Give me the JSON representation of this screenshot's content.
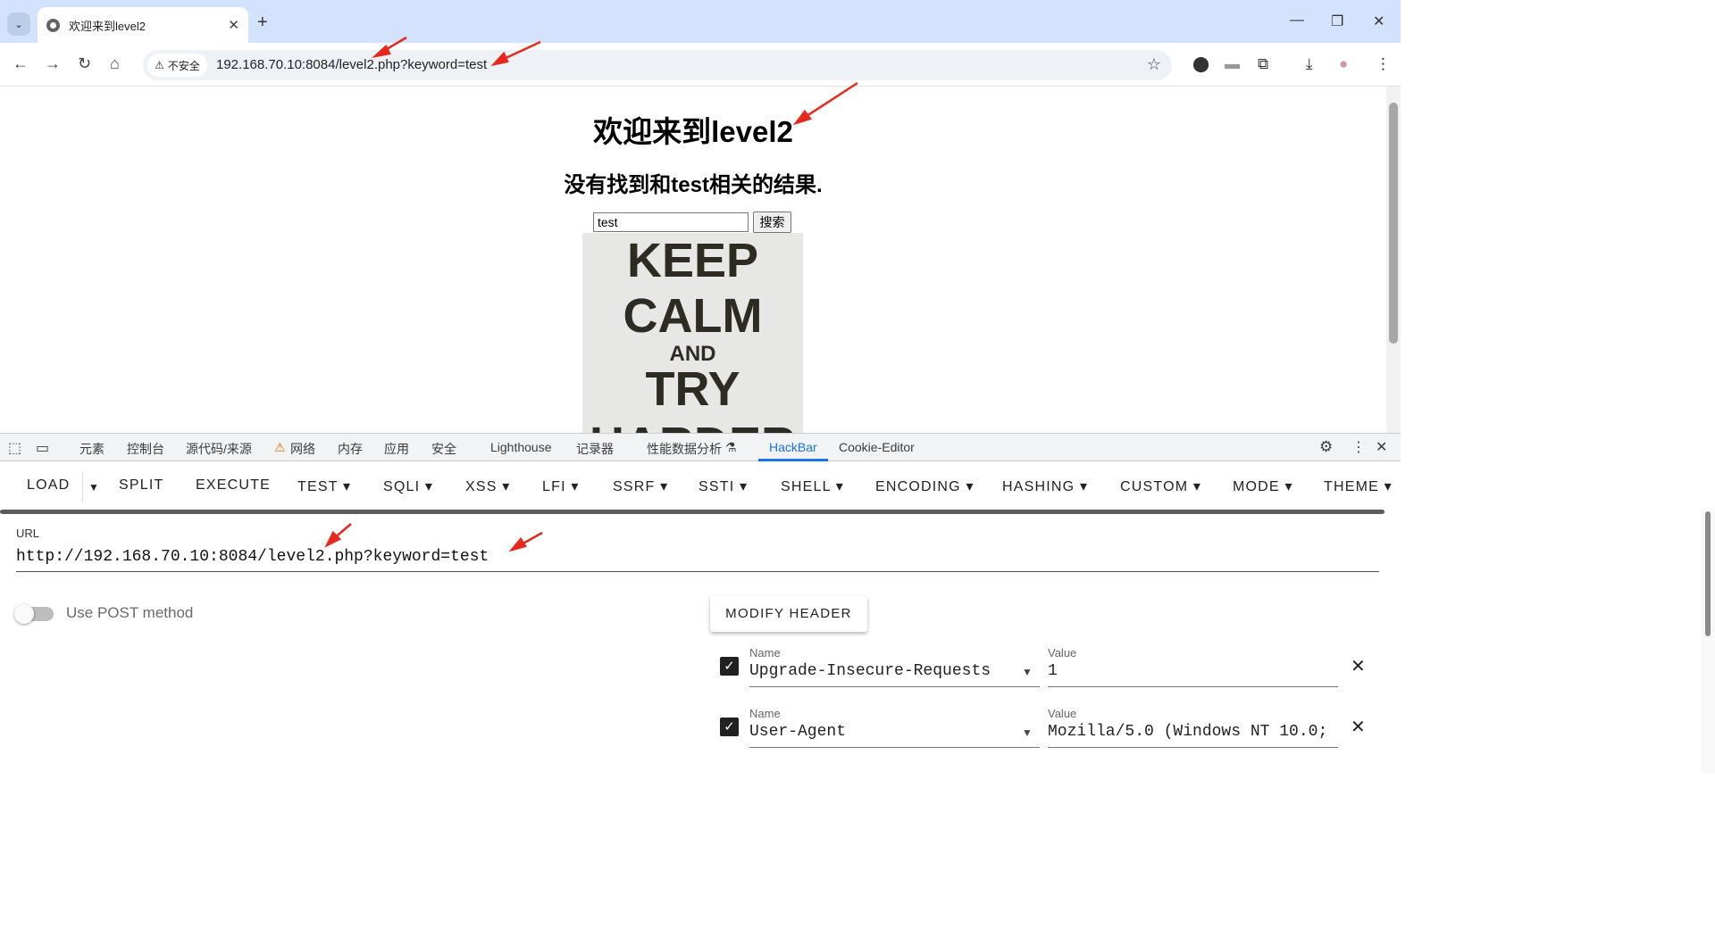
{
  "browser": {
    "tab_title": "欢迎来到level2",
    "tab_close": "✕",
    "new_tab": "+",
    "security_label": "不安全",
    "url": "192.168.70.10:8084/level2.php?keyword=test"
  },
  "page": {
    "heading": "欢迎来到level2",
    "subheading": "没有找到和test相关的结果.",
    "search_value": "test",
    "search_button": "搜索",
    "poster_lines": [
      "KEEP",
      "CALM",
      "AND",
      "TRY",
      "HARDER"
    ]
  },
  "devtools": {
    "tabs": [
      "元素",
      "控制台",
      "源代码/来源",
      "网络",
      "内存",
      "应用",
      "安全",
      "Lighthouse",
      "记录器",
      "性能数据分析",
      "HackBar",
      "Cookie-Editor"
    ],
    "active_tab": "HackBar"
  },
  "hackbar": {
    "menu": [
      "LOAD",
      "SPLIT",
      "EXECUTE",
      "TEST",
      "SQLI",
      "XSS",
      "LFI",
      "SSRF",
      "SSTI",
      "SHELL",
      "ENCODING",
      "HASHING",
      "CUSTOM",
      "MODE",
      "THEME"
    ],
    "url_label": "URL",
    "url_value": "http://192.168.70.10:8084/level2.php?keyword=test",
    "post_label": "Use POST method",
    "post_enabled": false,
    "modify_header_button": "MODIFY HEADER",
    "headers": [
      {
        "name_label": "Name",
        "name": "Upgrade-Insecure-Requests",
        "value_label": "Value",
        "value": "1",
        "checked": true
      },
      {
        "name_label": "Name",
        "name": "User-Agent",
        "value_label": "Value",
        "value": "Mozilla/5.0 (Windows NT 10.0;",
        "checked": true
      }
    ]
  },
  "colors": {
    "tabstrip": "#d3e3fd",
    "devtools_accent": "#1a73e8",
    "annotation_arrow": "#e8281c"
  }
}
